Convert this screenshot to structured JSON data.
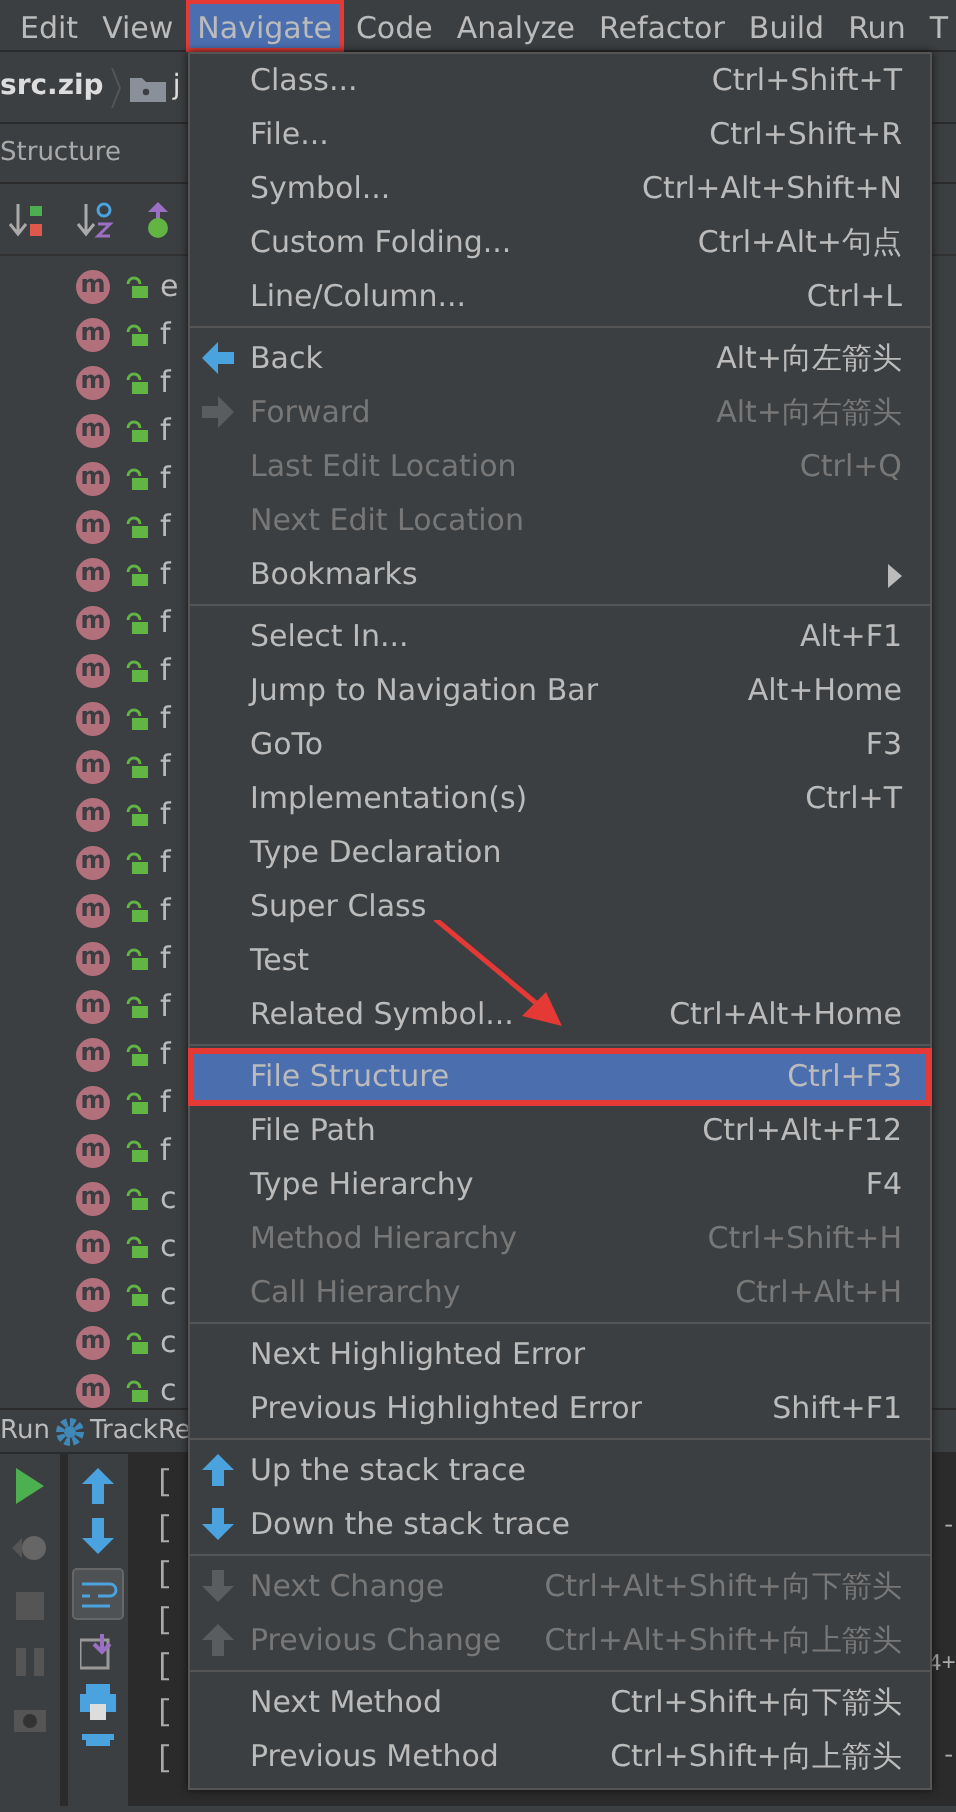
{
  "menubar": [
    {
      "label": "Edit",
      "selected": false,
      "annotated": false
    },
    {
      "label": "View",
      "selected": false,
      "annotated": false
    },
    {
      "label": "Navigate",
      "selected": true,
      "annotated": true
    },
    {
      "label": "Code",
      "selected": false,
      "annotated": false
    },
    {
      "label": "Analyze",
      "selected": false,
      "annotated": false
    },
    {
      "label": "Refactor",
      "selected": false,
      "annotated": false
    },
    {
      "label": "Build",
      "selected": false,
      "annotated": false
    },
    {
      "label": "Run",
      "selected": false,
      "annotated": false
    },
    {
      "label": "T",
      "selected": false,
      "annotated": false
    }
  ],
  "breadcrumb": [
    "src.zip",
    "j"
  ],
  "structure": {
    "title": "Structure",
    "rows": [
      {
        "badge": "m",
        "text": "e"
      },
      {
        "badge": "m",
        "text": "f"
      },
      {
        "badge": "m",
        "text": "f"
      },
      {
        "badge": "m",
        "text": "f"
      },
      {
        "badge": "m",
        "text": "f"
      },
      {
        "badge": "m",
        "text": "f"
      },
      {
        "badge": "m",
        "text": "f"
      },
      {
        "badge": "m",
        "text": "f"
      },
      {
        "badge": "m",
        "text": "f"
      },
      {
        "badge": "m",
        "text": "f"
      },
      {
        "badge": "m",
        "text": "f"
      },
      {
        "badge": "m",
        "text": "f"
      },
      {
        "badge": "m",
        "text": "f"
      },
      {
        "badge": "m",
        "text": "f"
      },
      {
        "badge": "m",
        "text": "f"
      },
      {
        "badge": "m",
        "text": "f"
      },
      {
        "badge": "m",
        "text": "f"
      },
      {
        "badge": "m",
        "text": "f"
      },
      {
        "badge": "m",
        "text": "f"
      },
      {
        "badge": "m",
        "text": "c"
      },
      {
        "badge": "m",
        "text": "c"
      },
      {
        "badge": "m",
        "text": "c"
      },
      {
        "badge": "m",
        "text": "c"
      },
      {
        "badge": "m",
        "text": "c"
      }
    ]
  },
  "run_panel": {
    "label": "Run",
    "config": "TrackRe",
    "console": [
      {
        "left": "["
      },
      {
        "left": "[",
        "right": "-"
      },
      {
        "left": "["
      },
      {
        "left": "["
      },
      {
        "left": "[",
        "right": "4+"
      },
      {
        "left": "["
      },
      {
        "left": "[",
        "right": "-"
      }
    ]
  },
  "menu": {
    "groups": [
      [
        {
          "label": "Class...",
          "shortcut": "Ctrl+Shift+T",
          "kind": "plain",
          "disabled": false,
          "selected": false
        },
        {
          "label": "File...",
          "shortcut": "Ctrl+Shift+R",
          "kind": "plain",
          "disabled": false,
          "selected": false
        },
        {
          "label": "Symbol...",
          "shortcut": "Ctrl+Alt+Shift+N",
          "kind": "plain",
          "disabled": false,
          "selected": false
        },
        {
          "label": "Custom Folding...",
          "shortcut": "Ctrl+Alt+句点",
          "kind": "plain",
          "disabled": false,
          "selected": false
        },
        {
          "label": "Line/Column...",
          "shortcut": "Ctrl+L",
          "kind": "plain",
          "disabled": false,
          "selected": false
        }
      ],
      [
        {
          "label": "Back",
          "shortcut": "Alt+向左箭头",
          "kind": "left",
          "disabled": false,
          "selected": false
        },
        {
          "label": "Forward",
          "shortcut": "Alt+向右箭头",
          "kind": "right",
          "disabled": true,
          "selected": false
        },
        {
          "label": "Last Edit Location",
          "shortcut": "Ctrl+Q",
          "kind": "plain",
          "disabled": true,
          "selected": false
        },
        {
          "label": "Next Edit Location",
          "kind": "plain",
          "disabled": true,
          "selected": false
        },
        {
          "label": "Bookmarks",
          "kind": "submenu",
          "disabled": false,
          "selected": false
        }
      ],
      [
        {
          "label": "Select In...",
          "shortcut": "Alt+F1",
          "kind": "plain",
          "disabled": false,
          "selected": false
        },
        {
          "label": "Jump to Navigation Bar",
          "shortcut": "Alt+Home",
          "kind": "plain",
          "disabled": false,
          "selected": false
        },
        {
          "label": "GoTo",
          "shortcut": "F3",
          "kind": "plain",
          "disabled": false,
          "selected": false
        },
        {
          "label": "Implementation(s)",
          "shortcut": "Ctrl+T",
          "kind": "plain",
          "disabled": false,
          "selected": false
        },
        {
          "label": "Type Declaration",
          "kind": "plain",
          "disabled": false,
          "selected": false
        },
        {
          "label": "Super Class",
          "kind": "plain",
          "disabled": false,
          "selected": false
        },
        {
          "label": "Test",
          "kind": "plain",
          "disabled": false,
          "selected": false
        },
        {
          "label": "Related Symbol...",
          "shortcut": "Ctrl+Alt+Home",
          "kind": "plain",
          "disabled": false,
          "selected": false
        }
      ],
      [
        {
          "label": "File Structure",
          "shortcut": "Ctrl+F3",
          "kind": "plain",
          "disabled": false,
          "selected": true,
          "annotated": true
        },
        {
          "label": "File Path",
          "shortcut": "Ctrl+Alt+F12",
          "kind": "plain",
          "disabled": false,
          "selected": false
        },
        {
          "label": "Type Hierarchy",
          "shortcut": "F4",
          "kind": "plain",
          "disabled": false,
          "selected": false
        },
        {
          "label": "Method Hierarchy",
          "shortcut": "Ctrl+Shift+H",
          "kind": "plain",
          "disabled": true,
          "selected": false
        },
        {
          "label": "Call Hierarchy",
          "shortcut": "Ctrl+Alt+H",
          "kind": "plain",
          "disabled": true,
          "selected": false
        }
      ],
      [
        {
          "label": "Next Highlighted Error",
          "kind": "plain",
          "disabled": false,
          "selected": false
        },
        {
          "label": "Previous Highlighted Error",
          "shortcut": "Shift+F1",
          "kind": "plain",
          "disabled": false,
          "selected": false
        }
      ],
      [
        {
          "label": "Up the stack trace",
          "kind": "up",
          "disabled": false,
          "selected": false
        },
        {
          "label": "Down the stack trace",
          "kind": "down",
          "disabled": false,
          "selected": false
        }
      ],
      [
        {
          "label": "Next Change",
          "shortcut": "Ctrl+Alt+Shift+向下箭头",
          "kind": "down",
          "disabled": true,
          "selected": false
        },
        {
          "label": "Previous Change",
          "shortcut": "Ctrl+Alt+Shift+向上箭头",
          "kind": "up",
          "disabled": true,
          "selected": false
        }
      ],
      [
        {
          "label": "Next Method",
          "shortcut": "Ctrl+Shift+向下箭头",
          "kind": "plain",
          "disabled": false,
          "selected": false
        },
        {
          "label": "Previous Method",
          "shortcut": "Ctrl+Shift+向上箭头",
          "kind": "plain",
          "disabled": false,
          "selected": false
        }
      ]
    ]
  }
}
